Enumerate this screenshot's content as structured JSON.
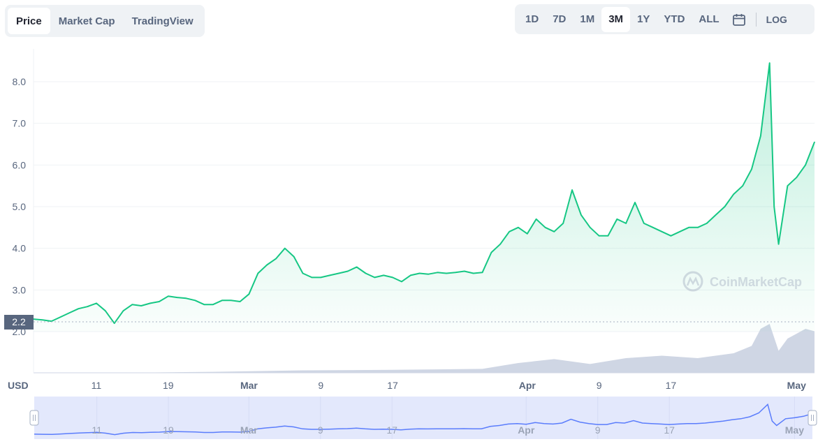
{
  "tabs": [
    "Price",
    "Market Cap",
    "TradingView"
  ],
  "active_tab": "Price",
  "ranges": [
    "1D",
    "7D",
    "1M",
    "3M",
    "1Y",
    "YTD",
    "ALL"
  ],
  "active_range": "3M",
  "log_label": "LOG",
  "currency_label": "USD",
  "current_price_label": "2.2",
  "watermark": "CoinMarketCap",
  "colors": {
    "line": "#16c784",
    "line_down": "#ea3943",
    "volume": "#cfd6e4",
    "navigator_fill": "#e3e8fc",
    "navigator_line": "#3861fb"
  },
  "chart_data": {
    "type": "area",
    "ylabel": "",
    "ylim": [
      1.0,
      8.8
    ],
    "y_ticks": [
      "2.0",
      "3.0",
      "4.0",
      "5.0",
      "6.0",
      "7.0",
      "8.0"
    ],
    "x_tick_labels": [
      {
        "label": "11",
        "day": 7,
        "bold": false
      },
      {
        "label": "19",
        "day": 15,
        "bold": false
      },
      {
        "label": "Mar",
        "day": 24,
        "bold": true
      },
      {
        "label": "9",
        "day": 32,
        "bold": false
      },
      {
        "label": "17",
        "day": 40,
        "bold": false
      },
      {
        "label": "Apr",
        "day": 55,
        "bold": true
      },
      {
        "label": "9",
        "day": 63,
        "bold": false
      },
      {
        "label": "17",
        "day": 71,
        "bold": false
      },
      {
        "label": "May",
        "day": 85,
        "bold": true
      }
    ],
    "x_range_days": [
      0,
      87
    ],
    "series": [
      {
        "values": [
          [
            0,
            2.3
          ],
          [
            1,
            2.28
          ],
          [
            2,
            2.25
          ],
          [
            3,
            2.35
          ],
          [
            4,
            2.45
          ],
          [
            5,
            2.55
          ],
          [
            6,
            2.6
          ],
          [
            7,
            2.68
          ],
          [
            8,
            2.5
          ],
          [
            9,
            2.2
          ],
          [
            10,
            2.5
          ],
          [
            11,
            2.65
          ],
          [
            12,
            2.62
          ],
          [
            13,
            2.68
          ],
          [
            14,
            2.72
          ],
          [
            15,
            2.85
          ],
          [
            16,
            2.82
          ],
          [
            17,
            2.8
          ],
          [
            18,
            2.75
          ],
          [
            19,
            2.65
          ],
          [
            20,
            2.65
          ],
          [
            21,
            2.75
          ],
          [
            22,
            2.75
          ],
          [
            23,
            2.72
          ],
          [
            24,
            2.9
          ],
          [
            25,
            3.4
          ],
          [
            26,
            3.6
          ],
          [
            27,
            3.75
          ],
          [
            28,
            4.0
          ],
          [
            29,
            3.8
          ],
          [
            30,
            3.4
          ],
          [
            31,
            3.3
          ],
          [
            32,
            3.3
          ],
          [
            33,
            3.35
          ],
          [
            34,
            3.4
          ],
          [
            35,
            3.45
          ],
          [
            36,
            3.55
          ],
          [
            37,
            3.4
          ],
          [
            38,
            3.3
          ],
          [
            39,
            3.35
          ],
          [
            40,
            3.3
          ],
          [
            41,
            3.2
          ],
          [
            42,
            3.35
          ],
          [
            43,
            3.4
          ],
          [
            44,
            3.38
          ],
          [
            45,
            3.42
          ],
          [
            46,
            3.4
          ],
          [
            47,
            3.42
          ],
          [
            48,
            3.45
          ],
          [
            49,
            3.4
          ],
          [
            50,
            3.42
          ],
          [
            51,
            3.9
          ],
          [
            52,
            4.1
          ],
          [
            53,
            4.4
          ],
          [
            54,
            4.5
          ],
          [
            55,
            4.35
          ],
          [
            56,
            4.7
          ],
          [
            57,
            4.5
          ],
          [
            58,
            4.4
          ],
          [
            59,
            4.6
          ],
          [
            60,
            5.4
          ],
          [
            61,
            4.8
          ],
          [
            62,
            4.5
          ],
          [
            63,
            4.3
          ],
          [
            64,
            4.3
          ],
          [
            65,
            4.7
          ],
          [
            66,
            4.6
          ],
          [
            67,
            5.1
          ],
          [
            68,
            4.6
          ],
          [
            69,
            4.5
          ],
          [
            70,
            4.4
          ],
          [
            71,
            4.3
          ],
          [
            72,
            4.4
          ],
          [
            73,
            4.5
          ],
          [
            74,
            4.5
          ],
          [
            75,
            4.6
          ],
          [
            76,
            4.8
          ],
          [
            77,
            5.0
          ],
          [
            78,
            5.3
          ],
          [
            79,
            5.5
          ],
          [
            80,
            5.9
          ],
          [
            81,
            6.7
          ],
          [
            82,
            8.45
          ],
          [
            82.5,
            5.0
          ],
          [
            83,
            4.1
          ],
          [
            84,
            5.5
          ],
          [
            85,
            5.7
          ],
          [
            86,
            6.0
          ],
          [
            87,
            6.55
          ]
        ]
      }
    ],
    "volume_series": [
      [
        0,
        0.0
      ],
      [
        10,
        0.0
      ],
      [
        20,
        0.02
      ],
      [
        30,
        0.05
      ],
      [
        40,
        0.06
      ],
      [
        50,
        0.08
      ],
      [
        54,
        0.2
      ],
      [
        58,
        0.28
      ],
      [
        62,
        0.18
      ],
      [
        66,
        0.3
      ],
      [
        70,
        0.35
      ],
      [
        74,
        0.3
      ],
      [
        78,
        0.4
      ],
      [
        80,
        0.55
      ],
      [
        81,
        0.9
      ],
      [
        82,
        1.0
      ],
      [
        83,
        0.45
      ],
      [
        84,
        0.7
      ],
      [
        86,
        0.9
      ],
      [
        87,
        0.85
      ]
    ],
    "navigator_x_ticks": [
      {
        "label": "11",
        "bold": false
      },
      {
        "label": "19",
        "bold": false
      },
      {
        "label": "Mar",
        "bold": true
      },
      {
        "label": "9",
        "bold": false
      },
      {
        "label": "17",
        "bold": false
      },
      {
        "label": "Apr",
        "bold": true
      },
      {
        "label": "9",
        "bold": false
      },
      {
        "label": "17",
        "bold": false
      },
      {
        "label": "May",
        "bold": true
      }
    ]
  }
}
